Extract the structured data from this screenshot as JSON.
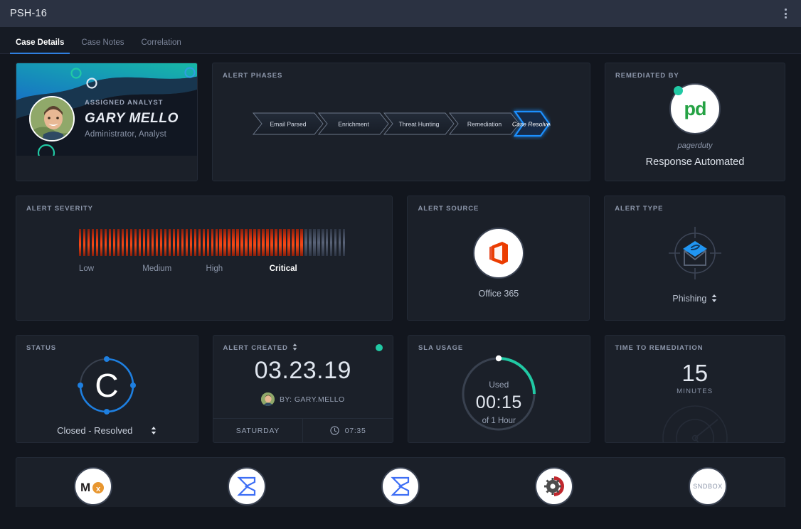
{
  "titlebar": {
    "title": "PSH-16",
    "menu_icon": "kebab-menu-icon"
  },
  "tabs": [
    {
      "label": "Case Details",
      "active": true
    },
    {
      "label": "Case Notes",
      "active": false
    },
    {
      "label": "Correlation",
      "active": false
    }
  ],
  "analyst": {
    "kicker": "ASSIGNED ANALYST",
    "name": "GARY MELLO",
    "role": "Administrator, Analyst"
  },
  "phases": {
    "label": "ALERT PHASES",
    "items": [
      {
        "label": "Email Parsed",
        "active": false
      },
      {
        "label": "Enrichment",
        "active": false
      },
      {
        "label": "Threat Hunting",
        "active": false
      },
      {
        "label": "Remediation",
        "active": false
      },
      {
        "label": "Case Resolved",
        "active": true
      }
    ]
  },
  "remediated": {
    "label": "REMEDIATED BY",
    "vendor": "pagerduty",
    "logo_text": "pd",
    "status": "Response Automated"
  },
  "severity": {
    "label": "ALERT SEVERITY",
    "levels": [
      "Low",
      "Medium",
      "High",
      "Critical"
    ],
    "active_level": "Critical",
    "total_ticks": 63,
    "filled_ticks": 53
  },
  "source": {
    "label": "ALERT SOURCE",
    "value": "Office 365",
    "icon": "office-365-icon"
  },
  "type": {
    "label": "ALERT TYPE",
    "value": "Phishing",
    "icon": "phishing-target-icon"
  },
  "status": {
    "label": "STATUS",
    "letter": "C",
    "value": "Closed - Resolved",
    "ring_percent": 75
  },
  "created": {
    "label": "ALERT CREATED",
    "date": "03.23.19",
    "by": "BY: GARY.MELLO",
    "day": "SATURDAY",
    "time": "07:35"
  },
  "sla": {
    "label": "SLA USAGE",
    "used_label": "Used",
    "value": "00:15",
    "of_label": "of 1 Hour",
    "percent": 25
  },
  "ttr": {
    "label": "TIME TO REMEDIATION",
    "value": "15",
    "unit": "MINUTES"
  },
  "integrations": [
    {
      "name": "mxtoolbox",
      "icon": "mxtoolbox-icon"
    },
    {
      "name": "sigma-1",
      "icon": "sigma-arrow-icon"
    },
    {
      "name": "sigma-2",
      "icon": "sigma-arrow-icon"
    },
    {
      "name": "gear-head",
      "icon": "gear-head-icon"
    },
    {
      "name": "sndbox",
      "icon": "sndbox-icon",
      "text": "SNDBOX"
    }
  ],
  "colors": {
    "accent_blue": "#1e90ff",
    "teal": "#21c9a4",
    "critical_red": "#ee3f13",
    "card_bg": "#1b2029",
    "page_bg": "#161b24"
  }
}
